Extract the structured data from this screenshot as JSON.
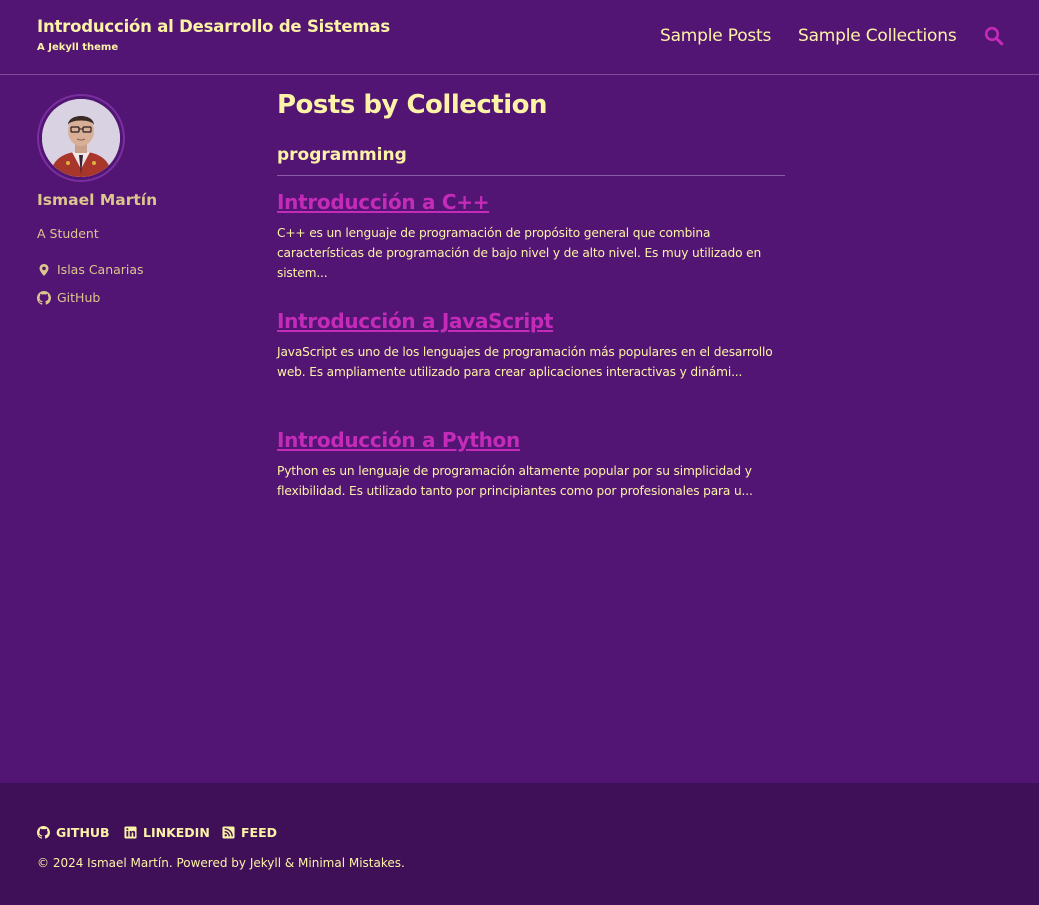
{
  "masthead": {
    "site_title": "Introducción al Desarrollo de Sistemas",
    "site_subtitle": "A Jekyll theme",
    "nav": [
      {
        "label": "Sample Posts"
      },
      {
        "label": "Sample Collections"
      }
    ],
    "search_icon": "search-icon"
  },
  "sidebar": {
    "author_name": "Ismael Martín",
    "author_bio": "A Student",
    "location": "Islas Canarias",
    "github_label": "GitHub"
  },
  "main": {
    "page_title": "Posts by Collection",
    "collection_name": "programming",
    "posts": [
      {
        "title": "Introducción a C++",
        "excerpt": "C++ es un lenguaje de programación de propósito general que combina características de programación de bajo nivel y de alto nivel. Es muy utilizado en sistem..."
      },
      {
        "title": "Introducción a JavaScript",
        "excerpt": "JavaScript es uno de los lenguajes de programación más populares en el desarrollo web. Es ampliamente utilizado para crear aplicaciones interactivas y dinámi..."
      },
      {
        "title": "Introducción a Python",
        "excerpt": "Python es un lenguaje de programación altamente popular por su simplicidad y flexibilidad. Es utilizado tanto por principiantes como por profesionales para u..."
      }
    ]
  },
  "footer": {
    "links": [
      {
        "label": "GITHUB",
        "icon": "github-icon"
      },
      {
        "label": "LINKEDIN",
        "icon": "linkedin-icon"
      },
      {
        "label": "FEED",
        "icon": "rss-icon"
      }
    ],
    "copyright_prefix": "© 2024 Ismael Martín. Powered by ",
    "jekyll": "Jekyll",
    "amp": " & ",
    "minimal_mistakes": "Minimal Mistakes",
    "period": "."
  },
  "colors": {
    "background": "#521574",
    "footer_background": "#3f1058",
    "text": "#fdf3a6",
    "sidebar_text": "#ddc58e",
    "link": "#c42bb8"
  }
}
